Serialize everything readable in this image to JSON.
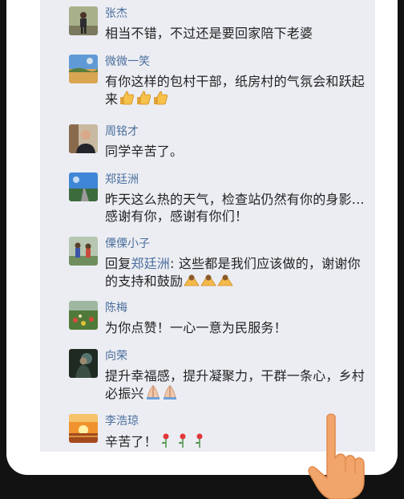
{
  "comments": [
    {
      "author": "张杰",
      "text": "相当不错，不过还是要回家陪下老婆",
      "avatar": "person-road-photo"
    },
    {
      "author": "微微一笑",
      "text": "有你这样的包村干部，纸房村的气氛会和跃起来",
      "avatar": "landscape-photo",
      "emoji": [
        "thumbs-up-icon",
        "thumbs-up-icon",
        "thumbs-up-icon"
      ]
    },
    {
      "author": "周铭才",
      "text": "同学辛苦了。",
      "avatar": "person-photo"
    },
    {
      "author": "郑廷洲",
      "text": "昨天这么热的天气，检查站仍然有你的身影...感谢有你，感谢有你们！",
      "avatar": "road-sky-photo"
    },
    {
      "author": "傈傈小子",
      "reply_prefix": "回复",
      "mention": "郑廷洲",
      "text": ": 这些都是我们应该做的，谢谢你的支持和鼓励",
      "avatar": "people-photo",
      "emoji": [
        "bow-icon",
        "bow-icon",
        "bow-icon"
      ]
    },
    {
      "author": "陈梅",
      "text": "为你点赞！一心一意为民服务！",
      "avatar": "flower-field-photo"
    },
    {
      "author": "向荣",
      "text": "提升幸福感，提升凝聚力，干群一条心，乡村必振兴",
      "avatar": "dark-portrait-photo",
      "emoji": [
        "pray-hands-icon",
        "pray-hands-icon"
      ]
    },
    {
      "author": "李浩琼",
      "text": "辛苦了！",
      "avatar": "sunset-photo",
      "emoji": [
        "rose-icon",
        "rose-icon",
        "rose-icon"
      ]
    }
  ],
  "colors": {
    "author": "#4a6f9e",
    "text": "#222222",
    "panel": "#ecedf2",
    "frame": "#121212"
  }
}
